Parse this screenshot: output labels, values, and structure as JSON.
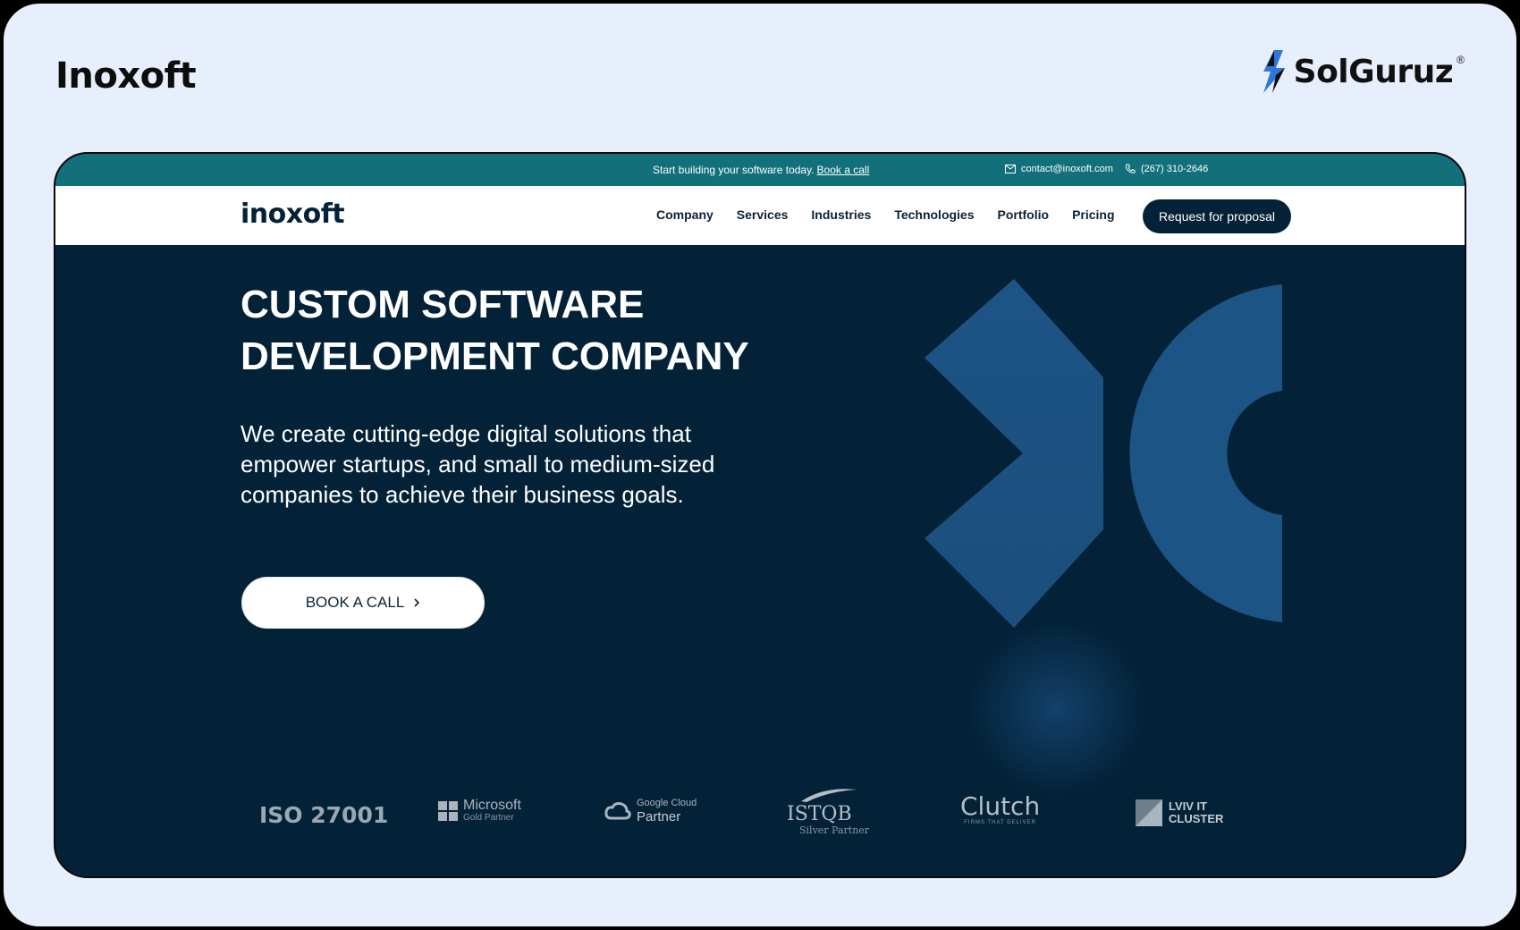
{
  "card": {
    "title": "Inoxoft",
    "brand": "SolGuruz",
    "brand_mark": "®"
  },
  "topbar": {
    "promo_text": "Start building your software today.",
    "promo_link": "Book a call",
    "email": "contact@inoxoft.com",
    "phone": "(267) 310-2646"
  },
  "nav": {
    "logo": "inoxoft",
    "items": [
      "Company",
      "Services",
      "Industries",
      "Technologies",
      "Portfolio",
      "Pricing"
    ],
    "cta": "Request for proposal"
  },
  "hero": {
    "title_line1": "CUSTOM SOFTWARE",
    "title_line2": "DEVELOPMENT COMPANY",
    "description": "We create cutting-edge digital solutions that empower startups, and small to medium-sized companies to achieve their business goals.",
    "button": "BOOK A CALL",
    "button_icon": "chevron-right-icon"
  },
  "partners": {
    "iso": "ISO 27001",
    "microsoft_1": "Microsoft",
    "microsoft_2": "Gold Partner",
    "google_1": "Google Cloud",
    "google_2": "Partner",
    "istqb_1": "ISTQB",
    "istqb_2": "Silver Partner",
    "clutch_1": "Clutch",
    "clutch_2": "FIRMS THAT DELIVER",
    "lviv_1": "LVIV IT",
    "lviv_2": "CLUSTER"
  },
  "colors": {
    "topbar": "#13707a",
    "hero_bg": "#042237",
    "shape": "#1b4f7e"
  }
}
